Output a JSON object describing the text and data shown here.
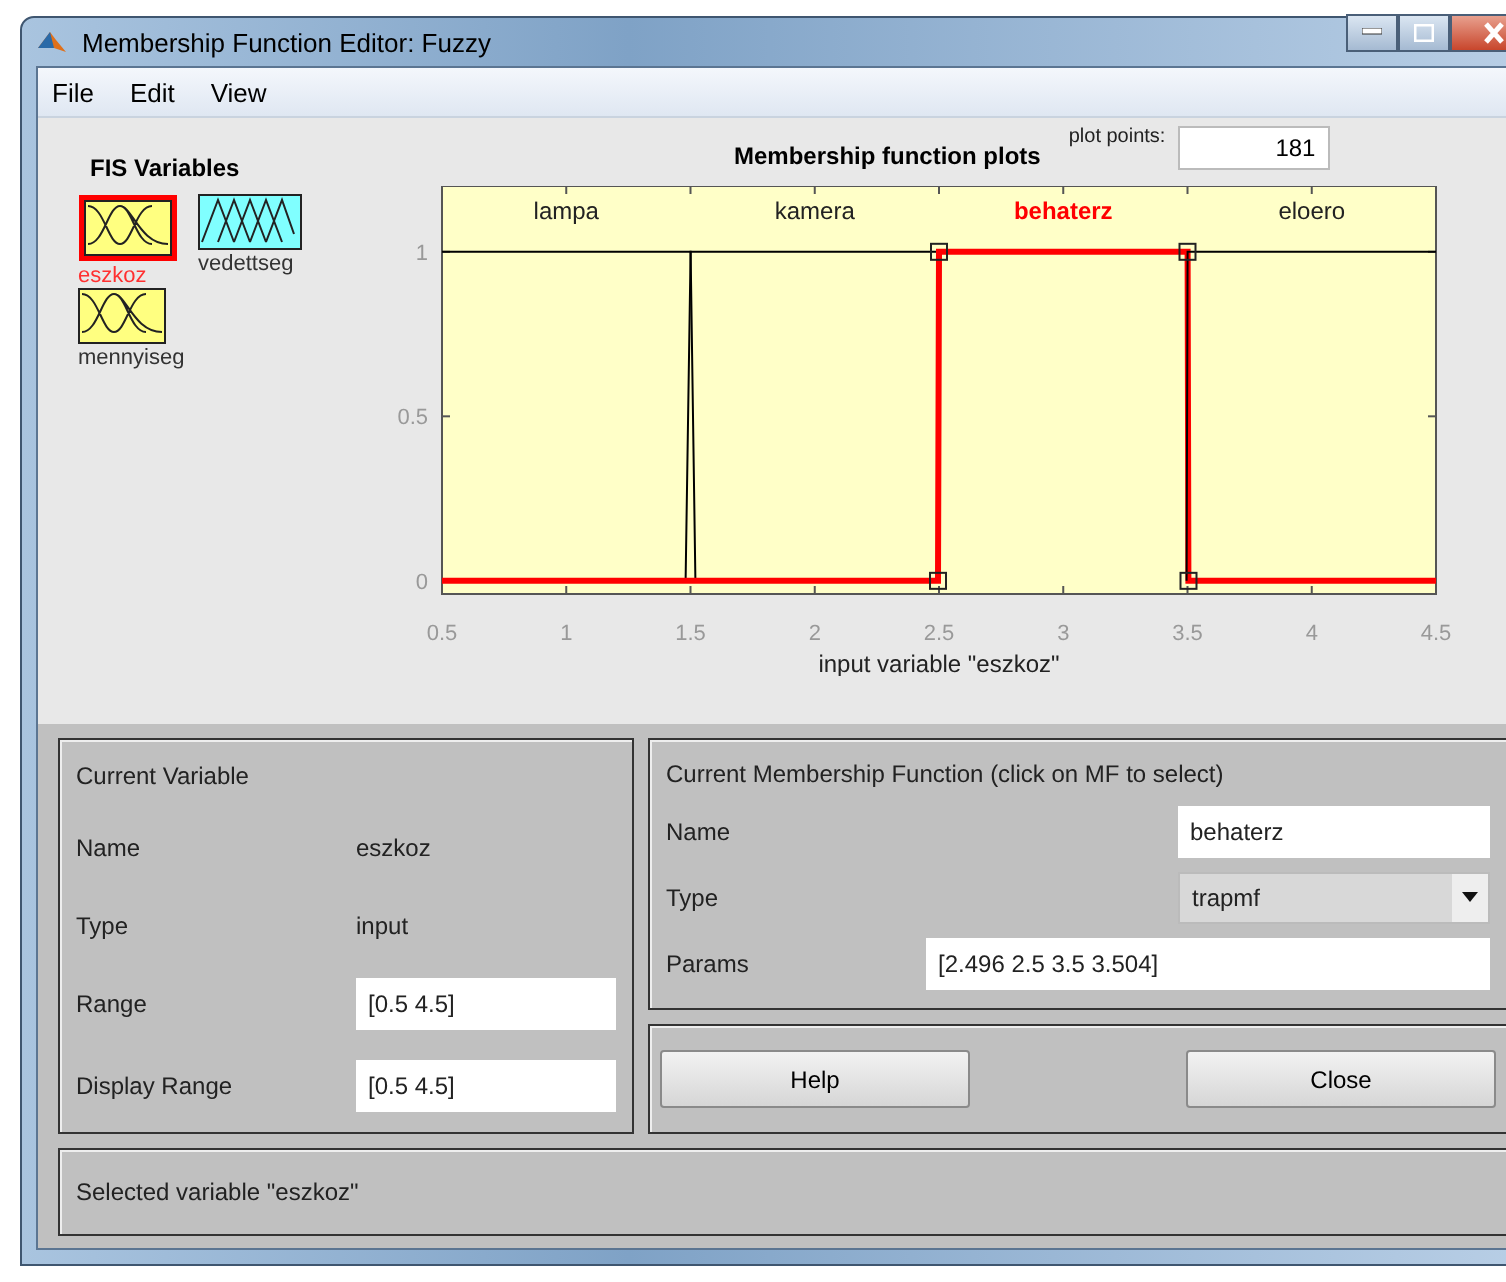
{
  "window": {
    "title": "Membership Function Editor: Fuzzy"
  },
  "menu": [
    "File",
    "Edit",
    "View"
  ],
  "fis_variables": {
    "title": "FIS Variables",
    "items": [
      {
        "name": "eszkoz",
        "kind": "input",
        "selected": true
      },
      {
        "name": "vedettseg",
        "kind": "output",
        "selected": false
      },
      {
        "name": "mennyiseg",
        "kind": "input",
        "selected": false
      }
    ]
  },
  "plot": {
    "plot_points_label": "plot points:",
    "plot_points": "181",
    "chart_data": {
      "type": "line",
      "title": "Membership function plots",
      "xlabel": "input variable \"eszkoz\"",
      "x": [
        0.5,
        1.48,
        1.5,
        1.52,
        2.496,
        2.5,
        2.504,
        3.496,
        3.5,
        3.504,
        4.5
      ],
      "series": [
        {
          "name": "lampa",
          "color": "#000000",
          "values": [
            1,
            1,
            1,
            0,
            null,
            null,
            null,
            null,
            null,
            null,
            null
          ]
        },
        {
          "name": "kamera",
          "color": "#000000",
          "values": [
            null,
            0,
            1,
            1,
            1,
            1,
            0,
            null,
            null,
            null,
            null
          ]
        },
        {
          "name": "behaterz",
          "color": "#ff0000",
          "values": [
            0,
            0,
            0,
            0,
            0,
            1,
            1,
            1,
            1,
            0,
            0
          ]
        },
        {
          "name": "eloero",
          "color": "#000000",
          "values": [
            null,
            null,
            null,
            null,
            null,
            null,
            null,
            0,
            1,
            1,
            1
          ]
        }
      ],
      "xlim": [
        0.5,
        4.5
      ],
      "ylim": [
        -0.04,
        1.2
      ],
      "xticks": [
        0.5,
        1,
        1.5,
        2,
        2.5,
        3,
        3.5,
        4,
        4.5
      ],
      "yticks": [
        0,
        0.5,
        1
      ]
    },
    "mfs": [
      {
        "selected": false
      },
      {
        "selected": false
      },
      {
        "selected": true
      },
      {
        "selected": false
      }
    ]
  },
  "current_variable": {
    "title": "Current Variable",
    "name_label": "Name",
    "name": "eszkoz",
    "type_label": "Type",
    "type": "input",
    "range_label": "Range",
    "range": "[0.5 4.5]",
    "display_range_label": "Display Range",
    "display_range": "[0.5 4.5]"
  },
  "current_mf": {
    "title": "Current Membership Function (click on MF to select)",
    "name_label": "Name",
    "name": "behaterz",
    "type_label": "Type",
    "type": "trapmf",
    "params_label": "Params",
    "params": "[2.496 2.5 3.5 3.504]"
  },
  "buttons": [
    "Help",
    "Close"
  ],
  "status": "Selected variable \"eszkoz\""
}
